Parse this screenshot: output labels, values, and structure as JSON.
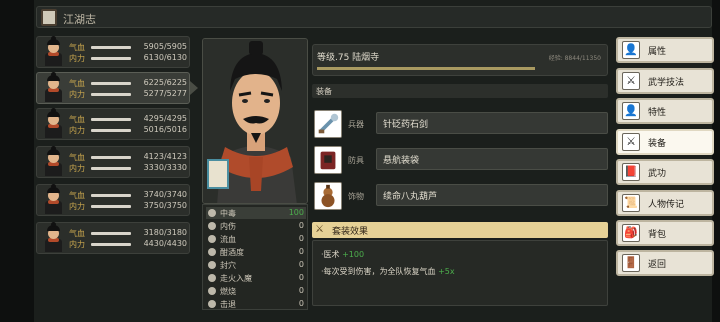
{
  "title": "江湖志",
  "heroes": [
    {
      "hp_label": "气血",
      "hp": "5905/5905",
      "mp_label": "内力",
      "mp": "6130/6130"
    },
    {
      "hp_label": "气血",
      "hp": "6225/6225",
      "mp_label": "内力",
      "mp": "5277/5277"
    },
    {
      "hp_label": "气血",
      "hp": "4295/4295",
      "mp_label": "内力",
      "mp": "5016/5016"
    },
    {
      "hp_label": "气血",
      "hp": "4123/4123",
      "mp_label": "内力",
      "mp": "3330/3330"
    },
    {
      "hp_label": "气血",
      "hp": "3740/3740",
      "mp_label": "内力",
      "mp": "3750/3750"
    },
    {
      "hp_label": "气血",
      "hp": "3180/3180",
      "mp_label": "内力",
      "mp": "4430/4430"
    }
  ],
  "selected_hero": 1,
  "character": {
    "level_text": "等级.75 陆烟寺",
    "exp_text": "经验: 8844/11350",
    "exp_fraction": 0.78
  },
  "status": [
    {
      "name": "中毒",
      "value": "100"
    },
    {
      "name": "内伤",
      "value": "0"
    },
    {
      "name": "流血",
      "value": "0"
    },
    {
      "name": "酣酒度",
      "value": "0"
    },
    {
      "name": "封穴",
      "value": "0"
    },
    {
      "name": "走火入魔",
      "value": "0"
    },
    {
      "name": "燃烧",
      "value": "0"
    },
    {
      "name": "击退",
      "value": "0"
    }
  ],
  "equipment_header": "装备",
  "equipment": [
    {
      "category": "兵器",
      "name": "针砭药石剑"
    },
    {
      "category": "防具",
      "name": "悬航装袋"
    },
    {
      "category": "饰物",
      "name": "续命八丸葫芦"
    }
  ],
  "set_effect": {
    "label": "套装效果",
    "lines": [
      {
        "text": "·医术 ",
        "bonus": "+100"
      },
      {
        "text": "·每次受到伤害，为全队恢复气血 ",
        "bonus": "+5x"
      }
    ]
  },
  "nav": [
    {
      "label": "属性",
      "icon": "👤"
    },
    {
      "label": "武学技法",
      "icon": "⚔"
    },
    {
      "label": "特性",
      "icon": "👤"
    },
    {
      "label": "装备",
      "icon": "⚔"
    },
    {
      "label": "武功",
      "icon": "📕"
    },
    {
      "label": "人物传记",
      "icon": "📜"
    },
    {
      "label": "背包",
      "icon": "🎒"
    },
    {
      "label": "返回",
      "icon": "🚪"
    }
  ],
  "selected_nav": 3,
  "colors": {
    "accent": "#e6d196",
    "bonus_green": "#4cae4c",
    "bar": "#a99a61"
  }
}
